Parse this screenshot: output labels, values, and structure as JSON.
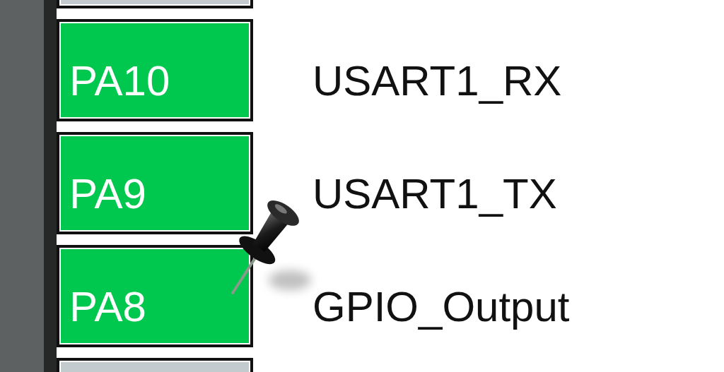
{
  "pins": [
    {
      "assigned": false,
      "pinned": false
    },
    {
      "name": "PA10",
      "signal": "USART1_RX",
      "assigned": true,
      "pinned": false
    },
    {
      "name": "PA9",
      "signal": "USART1_TX",
      "assigned": true,
      "pinned": true
    },
    {
      "name": "PA8",
      "signal": "GPIO_Output",
      "assigned": true,
      "pinned": false
    },
    {
      "assigned": false,
      "pinned": false
    }
  ]
}
